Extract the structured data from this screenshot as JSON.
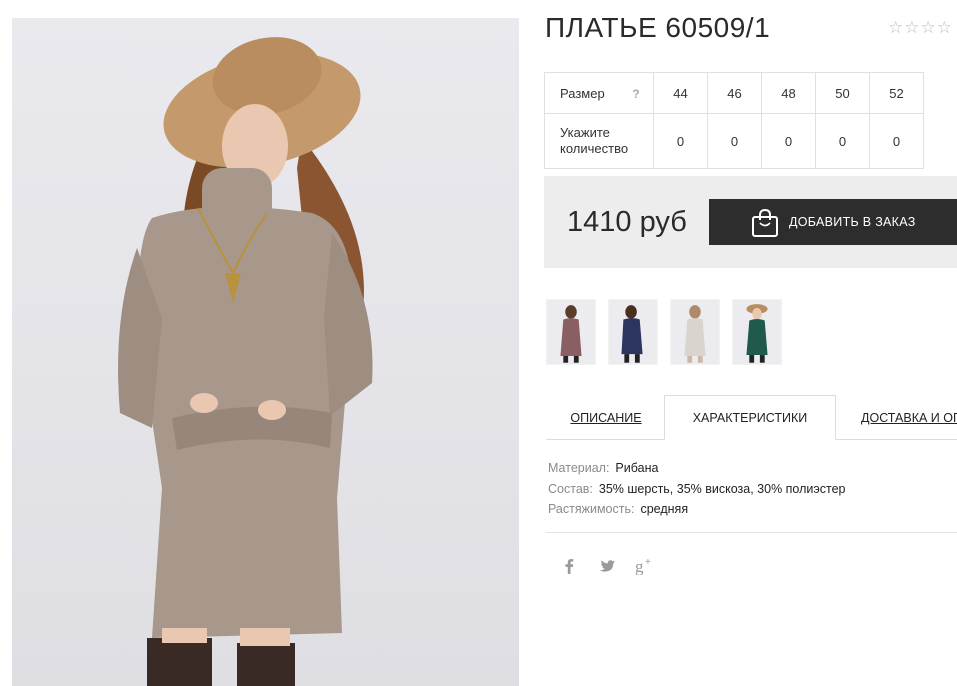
{
  "product": {
    "title": "ПЛАТЬЕ 60509/1",
    "rating_stars": 5,
    "price": "1410 руб",
    "add_button_label": "ДОБАВИТЬ В ЗАКАЗ"
  },
  "size_table": {
    "size_label": "Размер",
    "help_mark": "?",
    "qty_label_line1": "Укажите",
    "qty_label_line2": "количество",
    "sizes": [
      "44",
      "46",
      "48",
      "50",
      "52"
    ],
    "quantities": [
      "0",
      "0",
      "0",
      "0",
      "0"
    ]
  },
  "thumbnails": [
    {
      "color": "#8a5f63"
    },
    {
      "color": "#2c3560"
    },
    {
      "color": "#d9d4ce"
    },
    {
      "color": "#1f5a4d"
    }
  ],
  "tabs": [
    {
      "label": "ОПИСАНИЕ",
      "active": false
    },
    {
      "label": "ХАРАКТЕРИСТИКИ",
      "active": true
    },
    {
      "label": "ДОСТАВКА И ОП",
      "active": false
    }
  ],
  "characteristics": [
    {
      "key": "Материал:",
      "value": "Рибана"
    },
    {
      "key": "Состав:",
      "value": "35% шерсть, 35% вискоза, 30% полиэстер"
    },
    {
      "key": "Растяжимость:",
      "value": "средняя"
    }
  ],
  "social": [
    "facebook-icon",
    "twitter-icon",
    "google-plus-icon"
  ],
  "colors": {
    "dress": "#a8978b",
    "button_bg": "#2d2d2d",
    "order_bg": "#ededed"
  }
}
